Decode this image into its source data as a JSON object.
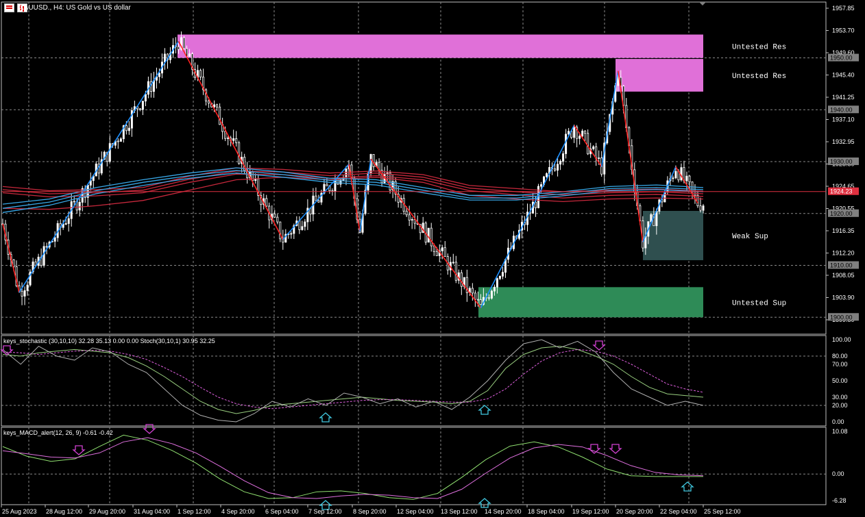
{
  "header": {
    "title": "XAUUSD., H4:  US Gold vs US dollar"
  },
  "stoch_header": "keys_stochastic (30,10,10) 32.28 35.13 0.00 0.00 Stoch(30,10,1) 30.95 32.25",
  "macd_header": "keys_MACD_alert(12, 26, 9) -0.61 -0.42",
  "colors": {
    "background": "#000000",
    "grid": "#8a8a8a",
    "bull": "#ffffff",
    "bear": "#000000",
    "zigzag_up": "#1e90ff",
    "zigzag_down": "#ff2020",
    "ma_red": "#c8283c",
    "ma_blue": "#38a8e8",
    "resistance_zone": "#e070d8",
    "weak_support_zone": "#2f4f4f",
    "untested_support_zone": "#2e8b57",
    "stoch_main": "#9ad080",
    "stoch_signal": "#e060e0",
    "stoch_raw": "#b0b0b0",
    "macd_main": "#90e070",
    "macd_signal": "#e070e0",
    "arrow_down": "#d040d0",
    "arrow_up": "#40c8e0"
  },
  "chart_data": [
    {
      "type": "candlestick",
      "symbol": "XAUUSD.",
      "timeframe": "H4",
      "price_axis": {
        "ylim": [
          1897.0,
          1960.5
        ],
        "ticks": [
          "1957.85",
          "1953.70",
          "1949.60",
          "1945.40",
          "1941.25",
          "1937.10",
          "1932.95",
          "1928.80",
          "1924.65",
          "1920.55",
          "1916.35",
          "1912.20",
          "1908.05",
          "1903.90",
          "1899.80"
        ]
      },
      "price_labels": [
        "1950.00",
        "1940.00",
        "1930.00",
        "1924.23",
        "1920.00",
        "1910.00",
        "1900.00"
      ],
      "current_price": 1924.23,
      "x_labels": [
        "25 Aug 2023",
        "28 Aug 12:00",
        "29 Aug 20:00",
        "31 Aug 04:00",
        "1 Sep 12:00",
        "4 Sep 20:00",
        "6 Sep 04:00",
        "7 Sep 12:00",
        "8 Sep 20:00",
        "12 Sep 04:00",
        "13 Sep 12:00",
        "14 Sep 20:00",
        "18 Sep 04:00",
        "19 Sep 12:00",
        "20 Sep 20:00",
        "22 Sep 04:00",
        "25 Sep 12:00"
      ],
      "zones": [
        {
          "label": "Untested Res",
          "from": 1950.0,
          "to": 1954.5
        },
        {
          "label": "Untested Res",
          "from": 1943.5,
          "to": 1949.8
        },
        {
          "label": "Weak Sup",
          "from": 1911.0,
          "to": 1920.5
        },
        {
          "label": "Untested Sup",
          "from": 1900.0,
          "to": 1905.8
        }
      ],
      "zigzag": [
        {
          "i": 0,
          "p": 1918.0
        },
        {
          "i": 6,
          "p": 1904.8
        },
        {
          "i": 64,
          "p": 1953.2
        },
        {
          "i": 102,
          "p": 1915.0
        },
        {
          "i": 126,
          "p": 1929.5
        },
        {
          "i": 130,
          "p": 1916.5
        },
        {
          "i": 134,
          "p": 1930.5
        },
        {
          "i": 174,
          "p": 1901.8
        },
        {
          "i": 208,
          "p": 1937.0
        },
        {
          "i": 218,
          "p": 1929.0
        },
        {
          "i": 224,
          "p": 1947.5
        },
        {
          "i": 233,
          "p": 1914.5
        },
        {
          "i": 245,
          "p": 1929.0
        },
        {
          "i": 253,
          "p": 1922.0
        }
      ],
      "ma_red": [
        [
          1925.2,
          1924.4,
          1924.6,
          1925.0,
          1927.2,
          1928.8,
          1928.5,
          1927.8,
          1928.2,
          1927.5,
          1925.4,
          1924.8,
          1924.2,
          1924.5,
          1924.7,
          1924.3
        ],
        [
          1924.6,
          1923.8,
          1924.0,
          1924.5,
          1926.6,
          1928.2,
          1928.0,
          1927.3,
          1927.8,
          1927.0,
          1924.9,
          1924.2,
          1923.6,
          1924.0,
          1924.2,
          1923.8
        ],
        [
          1924.0,
          1923.2,
          1923.4,
          1924.0,
          1926.0,
          1927.6,
          1927.5,
          1926.8,
          1927.3,
          1926.5,
          1924.4,
          1923.6,
          1923.0,
          1923.5,
          1923.7,
          1923.3
        ],
        [
          1921.0,
          1920.8,
          1921.5,
          1922.5,
          1924.5,
          1926.5,
          1927.0,
          1926.5,
          1927.0,
          1926.0,
          1923.5,
          1922.8,
          1922.3,
          1922.8,
          1923.0,
          1922.8
        ]
      ],
      "ma_blue": [
        [
          1921.8,
          1922.8,
          1925.0,
          1926.5,
          1927.8,
          1928.8,
          1928.0,
          1926.8,
          1926.5,
          1925.0,
          1923.5,
          1923.5,
          1924.2,
          1925.2,
          1925.5,
          1925.0
        ],
        [
          1921.0,
          1922.2,
          1924.4,
          1926.0,
          1927.3,
          1928.3,
          1927.5,
          1926.4,
          1926.0,
          1924.5,
          1923.0,
          1923.0,
          1923.8,
          1924.8,
          1925.0,
          1924.6
        ],
        [
          1920.2,
          1921.6,
          1923.8,
          1925.4,
          1926.8,
          1927.8,
          1927.0,
          1926.0,
          1925.5,
          1924.0,
          1922.6,
          1922.6,
          1923.4,
          1924.4,
          1924.6,
          1924.2
        ]
      ]
    },
    {
      "type": "line",
      "name": "keys_stochastic",
      "ylim": [
        0,
        100
      ],
      "ticks": [
        "100.00",
        "80.00",
        "70.00",
        "50.00",
        "30.00",
        "20.00",
        "0.00"
      ],
      "series": [
        {
          "values": [
            82,
            80,
            84,
            86,
            88,
            86,
            84,
            78,
            68,
            55,
            40,
            25,
            15,
            10,
            14,
            20,
            22,
            24,
            26,
            28,
            30,
            28,
            26,
            25,
            24,
            22,
            25,
            38,
            65,
            82,
            90,
            92,
            88,
            80,
            70,
            55,
            42,
            34,
            32,
            30
          ]
        },
        {
          "values": [
            85,
            84,
            82,
            84,
            86,
            87,
            86,
            82,
            76,
            66,
            55,
            42,
            30,
            22,
            18,
            16,
            18,
            20,
            22,
            24,
            26,
            27,
            27,
            26,
            25,
            24,
            24,
            28,
            40,
            58,
            74,
            84,
            88,
            86,
            80,
            70,
            58,
            46,
            40,
            36
          ]
        },
        {
          "values": [
            88,
            70,
            92,
            80,
            75,
            90,
            85,
            70,
            60,
            40,
            20,
            8,
            2,
            0,
            10,
            25,
            18,
            28,
            20,
            35,
            30,
            22,
            28,
            18,
            25,
            15,
            30,
            50,
            75,
            95,
            100,
            90,
            98,
            85,
            60,
            40,
            30,
            20,
            25,
            20
          ]
        }
      ]
    },
    {
      "type": "line",
      "name": "keys_MACD_alert",
      "ylim": [
        -6.28,
        10.08
      ],
      "ticks": [
        "10.08",
        "0.00",
        "-6.28"
      ],
      "series": [
        {
          "values": [
            6.5,
            4.2,
            3.0,
            3.6,
            6.5,
            9.2,
            8.0,
            5.6,
            2.6,
            -1.2,
            -4.2,
            -5.8,
            -5.6,
            -4.2,
            -4.0,
            -4.6,
            -5.6,
            -6.0,
            -4.6,
            -0.8,
            3.4,
            6.6,
            7.6,
            6.4,
            4.0,
            1.2,
            -0.4,
            -0.6,
            -0.6,
            -0.6
          ]
        },
        {
          "values": [
            5.5,
            4.8,
            4.0,
            3.8,
            5.0,
            7.6,
            8.6,
            7.2,
            5.0,
            1.8,
            -1.6,
            -4.4,
            -5.6,
            -5.8,
            -5.2,
            -4.8,
            -5.0,
            -5.6,
            -5.8,
            -3.6,
            0.2,
            3.8,
            6.2,
            7.0,
            6.4,
            4.4,
            2.0,
            0.4,
            -0.2,
            -0.4
          ]
        }
      ]
    }
  ]
}
